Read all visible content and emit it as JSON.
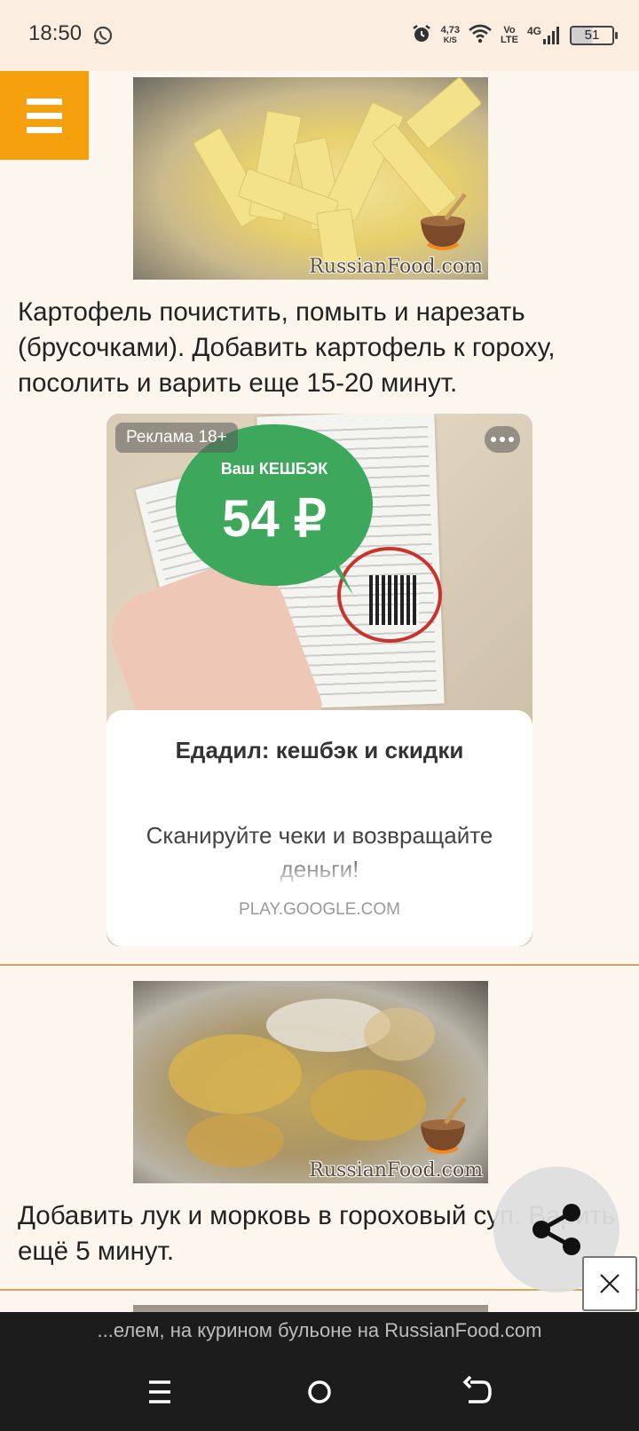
{
  "status_bar": {
    "time": "18:50",
    "net_speed_value": "4,73",
    "net_speed_unit": "K/S",
    "volte_top": "Vo",
    "volte_bottom": "LTE",
    "network_type": "4G",
    "battery": "51",
    "icons": [
      "whatsapp-icon",
      "alarm-icon",
      "wifi-icon",
      "signal-icon",
      "battery-icon"
    ]
  },
  "menu": {
    "icon": "hamburger-menu-icon"
  },
  "steps": [
    {
      "image_watermark": "RussianFood.com",
      "text": "Картофель почистить, помыть и нарезать (брусочками). Добавить картофель к гороху, посолить и варить еще 15-20 минут."
    },
    {
      "image_watermark": "RussianFood.com",
      "text": "Добавить лук и морковь в гороховый суп. Варить ещё 5 минут."
    }
  ],
  "ad": {
    "badge": "Реклама 18+",
    "cashback_label": "Ваш КЕШБЭК",
    "cashback_value": "54 ₽",
    "title": "Едадил: кешбэк и скидки",
    "description": "Сканируйте чеки и возвращайте деньги!",
    "domain": "PLAY.GOOGLE.COM"
  },
  "bottom_title": "...елем, на курином бульоне на RussianFood.com",
  "colors": {
    "page_bg": "#fdf6ee",
    "status_bg": "#fbeee0",
    "accent_orange": "#f5a00c",
    "divider": "#d7a35a",
    "cashback_green": "#3da85c",
    "nav_bg": "#1c1c1c"
  }
}
